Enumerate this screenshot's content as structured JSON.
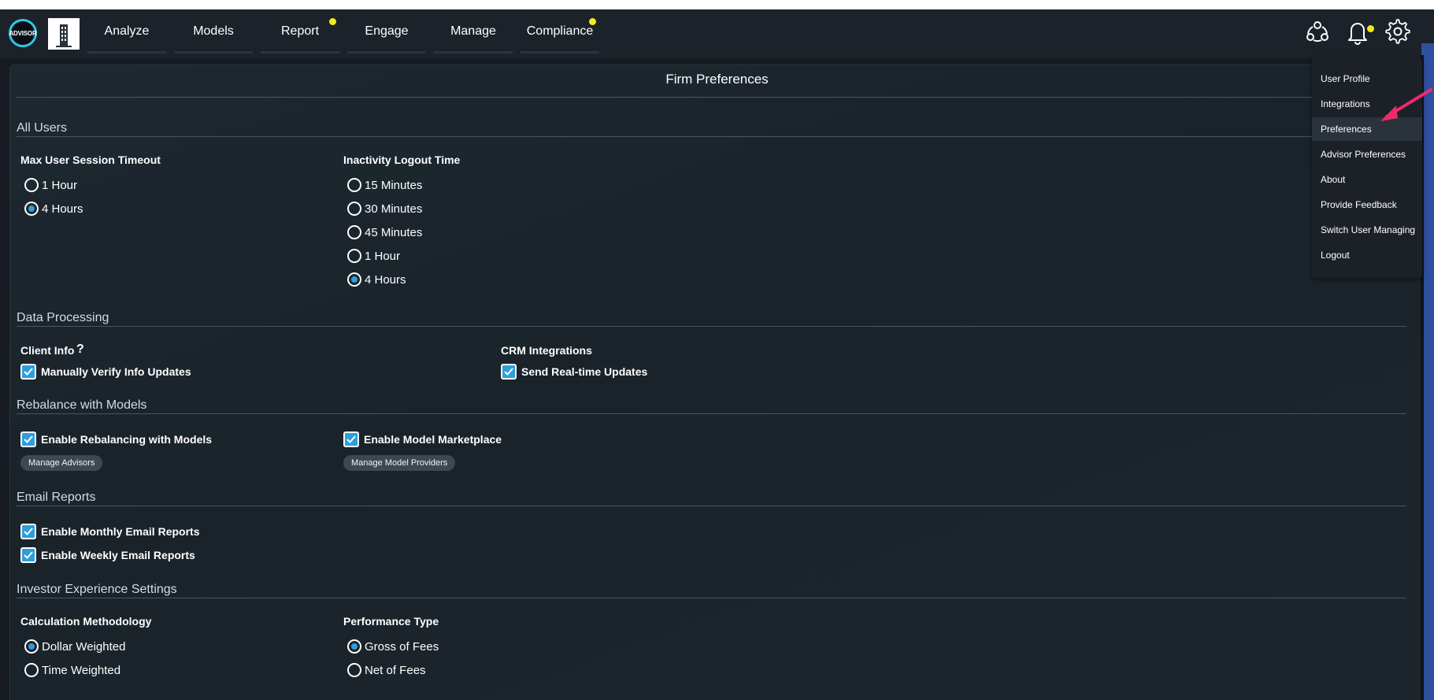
{
  "nav": {
    "logo_text": "ADVISOR",
    "items": [
      {
        "label": "Analyze"
      },
      {
        "label": "Models"
      },
      {
        "label": "Report"
      },
      {
        "label": "Engage"
      },
      {
        "label": "Manage"
      },
      {
        "label": "Compliance"
      }
    ],
    "icons": [
      "network-icon",
      "bell-icon",
      "gear-icon"
    ],
    "dot_color": "#f2ea1d"
  },
  "page": {
    "title": "Firm Preferences"
  },
  "all_users": {
    "section": "All Users",
    "session_timeout": {
      "label": "Max User Session Timeout",
      "options": [
        "1 Hour",
        "4 Hours"
      ],
      "selected": "4 Hours"
    },
    "inactivity": {
      "label": "Inactivity Logout Time",
      "options": [
        "15 Minutes",
        "30 Minutes",
        "45 Minutes",
        "1 Hour",
        "4 Hours"
      ],
      "selected": "4 Hours"
    }
  },
  "data_processing": {
    "section": "Data Processing",
    "client_info": {
      "label": "Client Info",
      "help": "?",
      "checkbox": "Manually Verify Info Updates",
      "checked": true
    },
    "crm": {
      "label": "CRM Integrations",
      "checkbox": "Send Real-time Updates",
      "checked": true
    }
  },
  "rebalance": {
    "section": "Rebalance with Models",
    "enable_rebalancing": {
      "label": "Enable Rebalancing with Models",
      "checked": true,
      "button": "Manage Advisors"
    },
    "marketplace": {
      "label": "Enable Model Marketplace",
      "checked": true,
      "button": "Manage Model Providers"
    }
  },
  "email_reports": {
    "section": "Email Reports",
    "monthly": {
      "label": "Enable Monthly Email Reports",
      "checked": true
    },
    "weekly": {
      "label": "Enable Weekly Email Reports",
      "checked": true
    }
  },
  "investor": {
    "section": "Investor Experience Settings",
    "calc": {
      "label": "Calculation Methodology",
      "options": [
        "Dollar Weighted",
        "Time Weighted"
      ],
      "selected": "Dollar Weighted"
    },
    "perf": {
      "label": "Performance Type",
      "options": [
        "Gross of Fees",
        "Net of Fees"
      ],
      "selected": "Gross of Fees"
    }
  },
  "settings_menu": {
    "items": [
      "User Profile",
      "Integrations",
      "Preferences",
      "Advisor Preferences",
      "About",
      "Provide Feedback",
      "Switch User Managing",
      "Logout"
    ],
    "active": "Preferences"
  },
  "colors": {
    "accent": "#2d9fdc",
    "annotation_arrow": "#ee2a6b"
  }
}
